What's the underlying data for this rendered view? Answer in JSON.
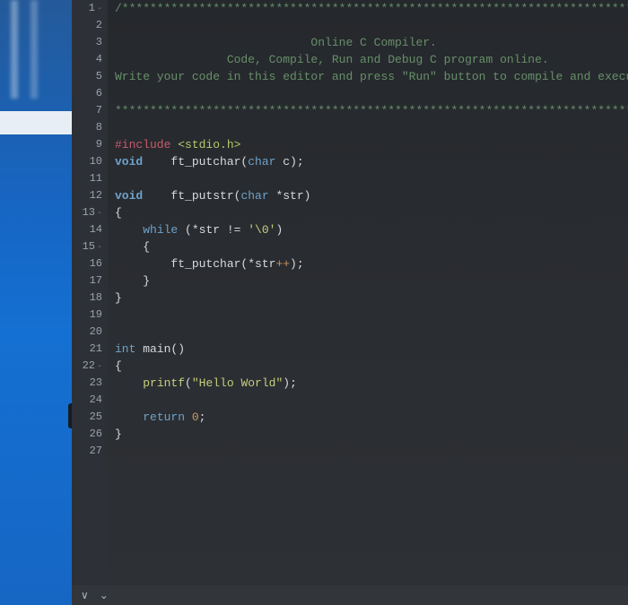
{
  "gutter": [
    {
      "n": "1",
      "fold": "-"
    },
    {
      "n": "2",
      "fold": ""
    },
    {
      "n": "3",
      "fold": ""
    },
    {
      "n": "4",
      "fold": ""
    },
    {
      "n": "5",
      "fold": ""
    },
    {
      "n": "6",
      "fold": ""
    },
    {
      "n": "7",
      "fold": ""
    },
    {
      "n": "8",
      "fold": ""
    },
    {
      "n": "9",
      "fold": ""
    },
    {
      "n": "10",
      "fold": ""
    },
    {
      "n": "11",
      "fold": ""
    },
    {
      "n": "12",
      "fold": ""
    },
    {
      "n": "13",
      "fold": "-"
    },
    {
      "n": "14",
      "fold": ""
    },
    {
      "n": "15",
      "fold": "-"
    },
    {
      "n": "16",
      "fold": ""
    },
    {
      "n": "17",
      "fold": ""
    },
    {
      "n": "18",
      "fold": ""
    },
    {
      "n": "19",
      "fold": ""
    },
    {
      "n": "20",
      "fold": ""
    },
    {
      "n": "21",
      "fold": ""
    },
    {
      "n": "22",
      "fold": "-"
    },
    {
      "n": "23",
      "fold": ""
    },
    {
      "n": "24",
      "fold": ""
    },
    {
      "n": "25",
      "fold": ""
    },
    {
      "n": "26",
      "fold": ""
    },
    {
      "n": "27",
      "fold": ""
    }
  ],
  "code": {
    "l1": "/******************************************************************************",
    "l2": "",
    "l3": "                            Online C Compiler.",
    "l4": "                Code, Compile, Run and Debug C program online.",
    "l5": "Write your code in this editor and press \"Run\" button to compile and execute it.",
    "l6": "",
    "l7": "*******************************************************************************/",
    "l8": "",
    "l9a": "#include ",
    "l9b": "<stdio.h>",
    "l10a": "void",
    "l10b": "    ft_putchar(",
    "l10c": "char",
    "l10d": " c);",
    "l11": "",
    "l12a": "void",
    "l12b": "    ft_putstr(",
    "l12c": "char",
    "l12d": " *str)",
    "l13": "{",
    "l14a": "    ",
    "l14b": "while",
    "l14c": " (*str != ",
    "l14d": "'\\0'",
    "l14e": ")",
    "l15": "    {",
    "l16a": "        ft_putchar(*str",
    "l16b": "++",
    "l16c": ");",
    "l17": "    }",
    "l18": "}",
    "l19": "",
    "l20": "",
    "l21a": "int",
    "l21b": " main()",
    "l22": "{",
    "l23a": "    ",
    "l23b": "printf",
    "l23c": "(",
    "l23d": "\"Hello World\"",
    "l23e": ");",
    "l24": "",
    "l25a": "    ",
    "l25b": "return",
    "l25c": " ",
    "l25d": "0",
    "l25e": ";",
    "l26": "}",
    "l27": ""
  },
  "collapse_icon": "<",
  "statusbar": {
    "a": "∨",
    "b": "⌄"
  }
}
